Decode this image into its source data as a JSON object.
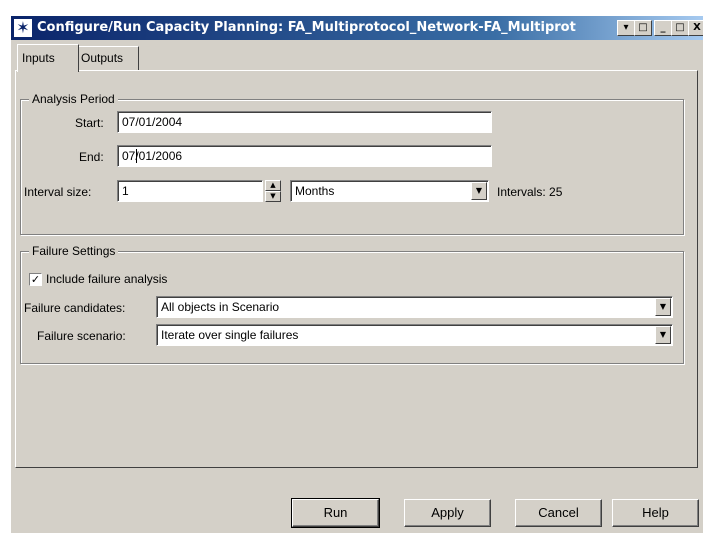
{
  "window": {
    "title": "Configure/Run Capacity Planning: FA_Multiprotocol_Network-FA_Multiprot",
    "title_icon": "✶",
    "buttons": [
      "▾",
      "□",
      "_",
      "□",
      "X"
    ]
  },
  "tabs": [
    {
      "label": "Inputs",
      "active": true
    },
    {
      "label": "Outputs",
      "active": false
    }
  ],
  "analysis_period": {
    "title": "Analysis Period",
    "start_label": "Start:",
    "start_value": "07/01/2004",
    "end_label": "End:",
    "end_value": "07/01/2006",
    "interval_label": "Interval size:",
    "interval_value": "1",
    "unit_value": "Months",
    "intervals_text": "Intervals: 25"
  },
  "failure_settings": {
    "title": "Failure Settings",
    "include_label": "Include failure analysis",
    "include_checked": true,
    "candidates_label": "Failure candidates:",
    "candidates_value": "All objects in Scenario",
    "scenario_label": "Failure scenario:",
    "scenario_value": "Iterate over single failures"
  },
  "actions": {
    "run": "Run",
    "apply": "Apply",
    "cancel": "Cancel",
    "help": "Help"
  },
  "icons": {
    "dropdown": "▼",
    "spin_up": "▲",
    "spin_down": "▼",
    "check": "✓"
  }
}
